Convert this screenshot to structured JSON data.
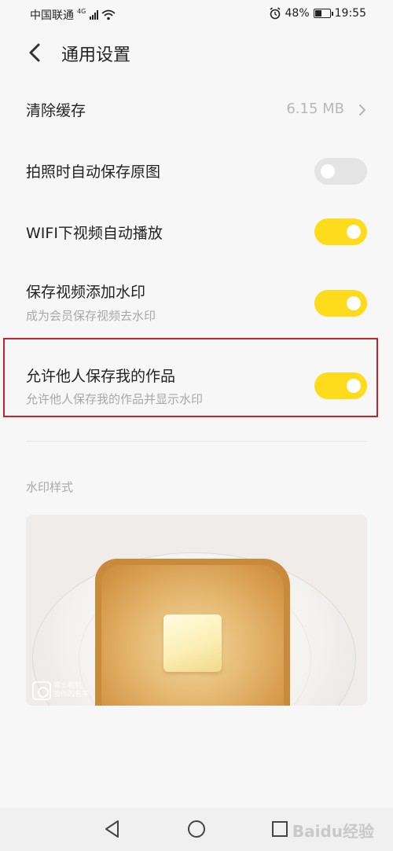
{
  "status_bar": {
    "carrier": "中国联通",
    "network": "4G",
    "battery": "48%",
    "battery_level": 0.48,
    "time": "19:55"
  },
  "header": {
    "title": "通用设置",
    "back_icon": "chevron-left-icon"
  },
  "settings": {
    "clear_cache": {
      "label": "清除缓存",
      "value": "6.15 MB"
    },
    "auto_save_original": {
      "label": "拍照时自动保存原图",
      "enabled": false
    },
    "wifi_autoplay": {
      "label": "WIFI下视频自动播放",
      "enabled": true
    },
    "video_watermark": {
      "label": "保存视频添加水印",
      "sublabel": "成为会员保存视频去水印",
      "enabled": true
    },
    "allow_save": {
      "label": "允许他人保存我的作品",
      "sublabel": "允许他人保存我的作品并显示水印",
      "enabled": true
    }
  },
  "watermark_section": {
    "title": "水印样式",
    "preview_caption_line1": "富士相机",
    "preview_caption_line2": "拍你的名字"
  },
  "nav_bar": {
    "back_icon": "triangle-back-icon",
    "home_icon": "circle-home-icon",
    "recent_icon": "square-recent-icon",
    "site_watermark": "Baidu经验"
  },
  "colors": {
    "toggle_on": "#fedb1b",
    "toggle_off": "#e4e4e4",
    "highlight_border": "#c72228"
  }
}
